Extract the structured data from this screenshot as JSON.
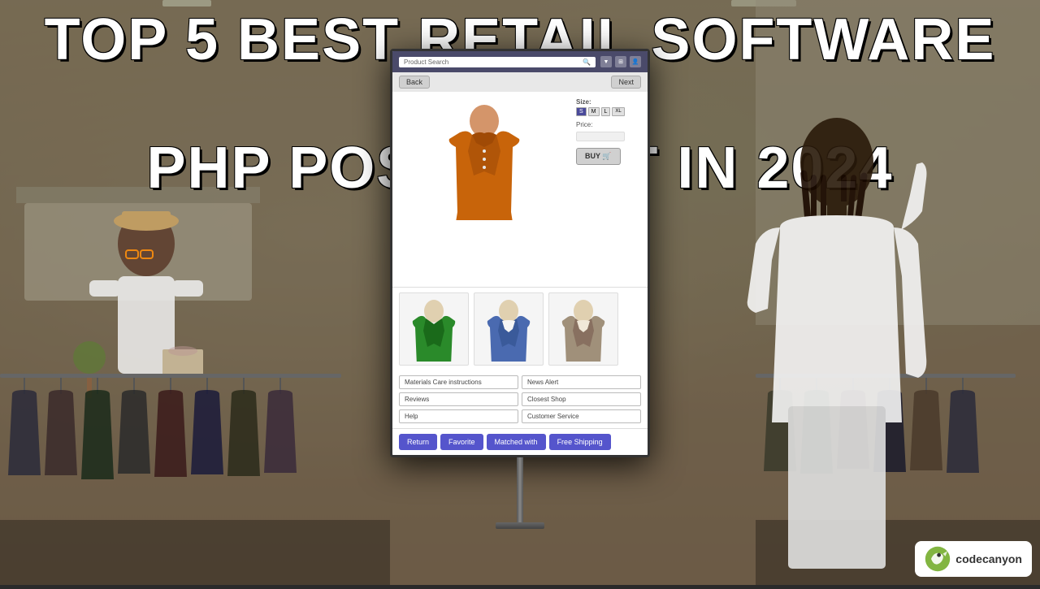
{
  "page": {
    "title": "TOP 5 BEST RETAIL SOFTWARE & PHP POS SCRIPT IN 2024",
    "headline": {
      "line1": "TOP 5 BEST RETAIL SOFTWARE",
      "line2": "&",
      "line3": "PHP POS SCRIPT IN 2024"
    }
  },
  "kiosk": {
    "header": {
      "search_placeholder": "Product Search",
      "search_icon": "🔍"
    },
    "nav": {
      "back_label": "Back",
      "next_label": "Next"
    },
    "product": {
      "size_label": "Size:",
      "sizes": [
        "S",
        "M",
        "L",
        "XL"
      ],
      "active_size": "S",
      "price_label": "Price:",
      "buy_label": "BUY 🛒"
    },
    "info_buttons": [
      "Materials  Care instructions",
      "News  Alert",
      "Reviews",
      "Closest Shop",
      "Help",
      "Customer Service"
    ],
    "action_buttons": {
      "return": "Return",
      "favorite": "Favorite",
      "matched_with": "Matched with",
      "free_shipping": "Free Shipping"
    }
  },
  "codecanyon": {
    "name": "codecanyon"
  }
}
